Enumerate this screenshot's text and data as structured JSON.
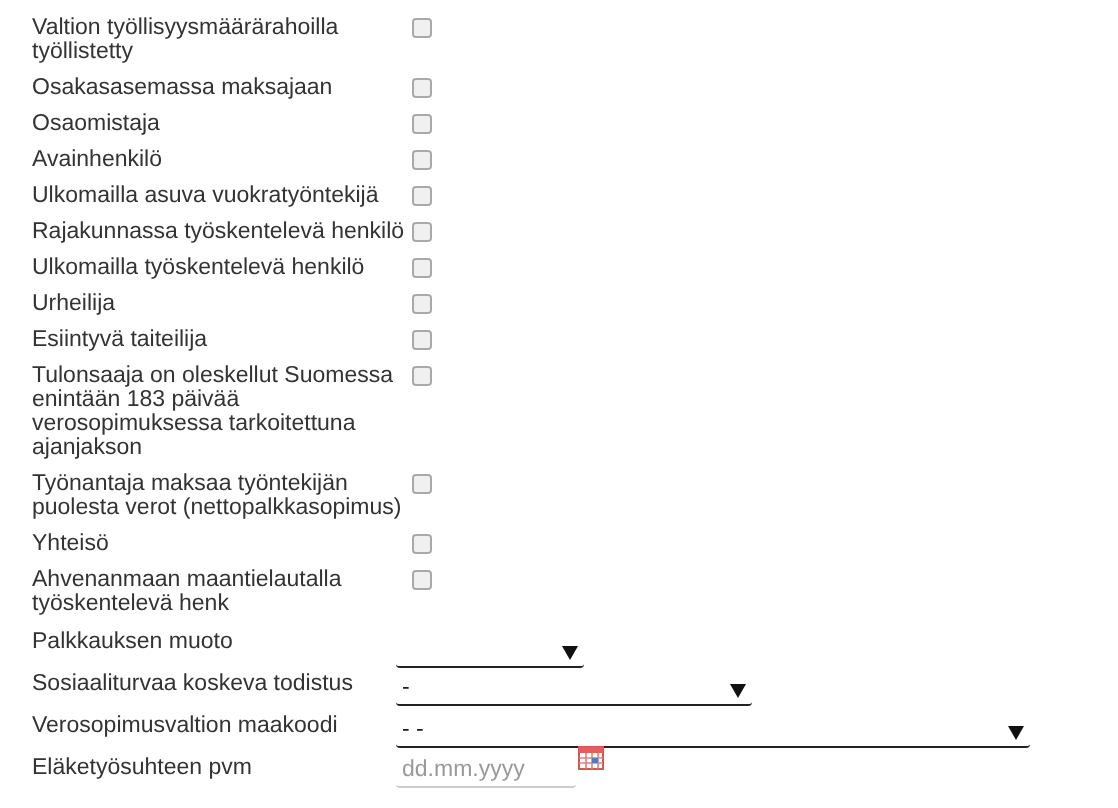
{
  "checkboxes": [
    {
      "label": "Valtion työllisyysmäärärahoilla työllistetty",
      "checked": false
    },
    {
      "label": "Osakasasemassa maksajaan",
      "checked": false
    },
    {
      "label": "Osaomistaja",
      "checked": false
    },
    {
      "label": "Avainhenkilö",
      "checked": false
    },
    {
      "label": "Ulkomailla asuva vuokratyöntekijä",
      "checked": false
    },
    {
      "label": "Rajakunnassa työskentelevä henkilö",
      "checked": false
    },
    {
      "label": "Ulkomailla työskentelevä henkilö",
      "checked": false
    },
    {
      "label": "Urheilija",
      "checked": false
    },
    {
      "label": "Esiintyvä taiteilija",
      "checked": false
    },
    {
      "label": "Tulonsaaja on oleskellut Suomessa enintään 183 päivää verosopimuksessa tarkoitettuna ajanjakson",
      "checked": false
    },
    {
      "label": "Työnantaja maksaa työntekijän puolesta verot (nettopalkkasopimus)",
      "checked": false
    },
    {
      "label": "Yhteisö",
      "checked": false
    },
    {
      "label": "Ahvenanmaan maantielautalla työskentelevä henk",
      "checked": false
    }
  ],
  "fields": [
    {
      "kind": "select",
      "label": "Palkkauksen muoto"
    },
    {
      "kind": "select",
      "label": "Sosiaaliturvaa koskeva todistus",
      "value": "-"
    },
    {
      "kind": "select",
      "label": "Verosopimusvaltion maakoodi",
      "value": "- -"
    },
    {
      "kind": "date",
      "label": "Eläketyösuhteen pvm",
      "placeholder": "dd.mm.yyyy"
    }
  ]
}
